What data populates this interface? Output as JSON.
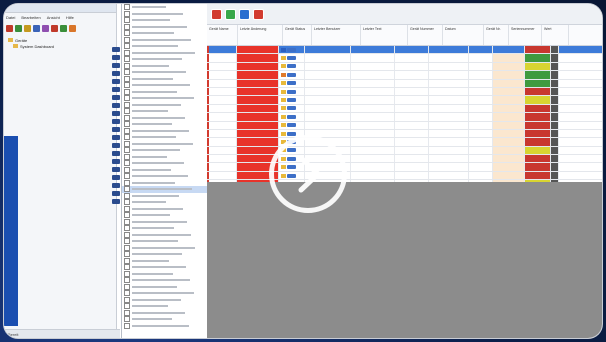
{
  "window": {
    "menu": [
      "Datei",
      "Bearbeiten",
      "Ansicht",
      "Hilfe"
    ],
    "toolbar_colors": [
      "#c03a2b",
      "#3a8e3a",
      "#c59a20",
      "#3a63b8",
      "#8f4fb0",
      "#c03a2b",
      "#3a8e3a",
      "#d9762a"
    ]
  },
  "tree": {
    "nodes": [
      "Geräte",
      "System Dashboard"
    ]
  },
  "main_toolbar": {
    "buttons": [
      {
        "icon": "stop-icon",
        "color": "#d23b2f"
      },
      {
        "icon": "run-icon",
        "color": "#38a84a"
      },
      {
        "icon": "refresh-icon",
        "color": "#2b6fd0"
      },
      {
        "icon": "stop-icon",
        "color": "#d23b2f"
      }
    ]
  },
  "status_bar": {
    "text": "Bereit"
  },
  "table": {
    "columns": [
      "Gerät Name",
      "Letzte Änderung",
      "Gerät Status",
      "Letzter Benutzer",
      "Letzter Text",
      "Gerät Nummer",
      "Datum",
      "Gerät Nr.",
      "Seriennummer",
      "Wert"
    ],
    "rows": [
      {
        "status": "fail",
        "value_color": "#c8372f"
      },
      {
        "status": "ok",
        "value_color": "#3f9a3f"
      },
      {
        "status": "ok",
        "value_color": "#d8d431"
      },
      {
        "status": "warn",
        "value_color": "#3f9a3f"
      },
      {
        "status": "ok",
        "value_color": "#3f9a3f"
      },
      {
        "status": "ok",
        "value_color": "#c8372f"
      },
      {
        "status": "ok",
        "value_color": "#d8d431"
      },
      {
        "status": "ok",
        "value_color": "#c8372f"
      },
      {
        "status": "ok",
        "value_color": "#c8372f"
      },
      {
        "status": "ok",
        "value_color": "#c8372f"
      },
      {
        "status": "ok",
        "value_color": "#c8372f"
      },
      {
        "status": "ok",
        "value_color": "#c8372f"
      },
      {
        "status": "ok",
        "value_color": "#d8d431"
      },
      {
        "status": "ok",
        "value_color": "#c8372f"
      },
      {
        "status": "ok",
        "value_color": "#c8372f"
      },
      {
        "status": "ok",
        "value_color": "#c8372f"
      },
      {
        "status": "ok",
        "value_color": "#d8d431"
      },
      {
        "status": "ok",
        "value_color": "#c8372f"
      }
    ]
  },
  "overlay": {
    "play_icon": "play-icon"
  }
}
